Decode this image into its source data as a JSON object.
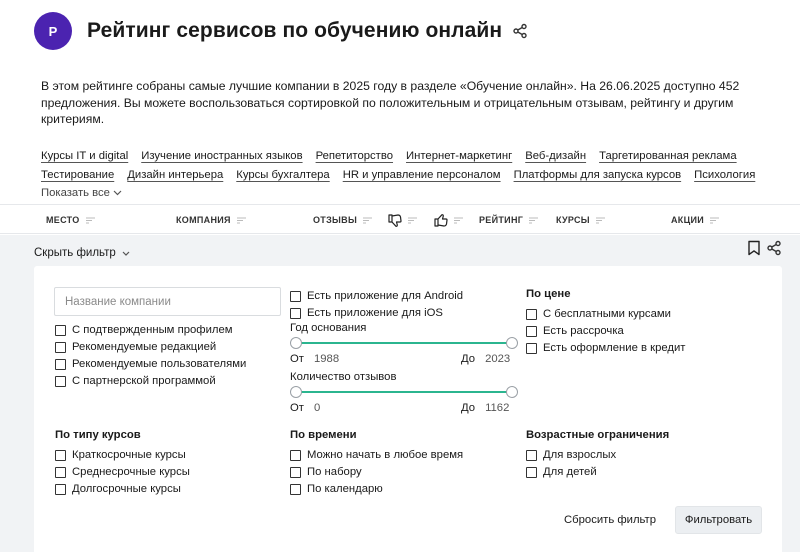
{
  "header": {
    "avatar_letter": "P",
    "title": "Рейтинг сервисов по обучению онлайн",
    "accent": "#4b23b0"
  },
  "intro": "В этом рейтинге собраны самые лучшие компании в 2025 году в разделе «Обучение онлайн». На 26.06.2025 доступно 452 предложения. Вы можете воспользоваться сортировкой по положительным и отрицательным отзывам, рейтингу и другим критериям.",
  "categories": {
    "row1": [
      "Курсы IT и digital",
      "Изучение иностранных языков",
      "Репетиторство",
      "Интернет-маркетинг",
      "Веб-дизайн",
      "Таргетированная реклама"
    ],
    "row2": [
      "Тестирование",
      "Дизайн интерьера",
      "Курсы бухгалтера",
      "HR и управление персоналом",
      "Платформы для запуска курсов",
      "Психология"
    ],
    "show_all": "Показать все"
  },
  "table_header": {
    "place": "МЕСТО",
    "company": "КОМПАНИЯ",
    "reviews": "ОТЗЫВЫ",
    "rating": "РЕЙТИНГ",
    "courses": "КУРСЫ",
    "promos": "АКЦИИ"
  },
  "filter": {
    "hide_label": "Скрыть фильтр",
    "company_placeholder": "Название компании",
    "company_flags": [
      "С подтвержденным профилем",
      "Рекомендуемые редакцией",
      "Рекомендуемые пользователями",
      "С партнерской программой"
    ],
    "apps": [
      "Есть приложение для Android",
      "Есть приложение для iOS"
    ],
    "founded": {
      "label": "Год основания",
      "from_label": "От",
      "from": "1988",
      "to_label": "До",
      "to": "2023"
    },
    "reviews_count": {
      "label": "Количество отзывов",
      "from_label": "От",
      "from": "0",
      "to_label": "До",
      "to": "1162"
    },
    "price": {
      "title": "По цене",
      "options": [
        "С бесплатными курсами",
        "Есть рассрочка",
        "Есть оформление в кредит"
      ]
    },
    "course_type": {
      "title": "По типу курсов",
      "options": [
        "Краткосрочные курсы",
        "Среднесрочные курсы",
        "Долгосрочные курсы"
      ]
    },
    "time": {
      "title": "По времени",
      "options": [
        "Можно начать в любое время",
        "По набору",
        "По календарю"
      ]
    },
    "age": {
      "title": "Возрастные ограничения",
      "options": [
        "Для взрослых",
        "Для детей"
      ]
    },
    "reset_label": "Сбросить фильтр",
    "apply_label": "Фильтровать",
    "slider_color": "#2bb58f"
  }
}
